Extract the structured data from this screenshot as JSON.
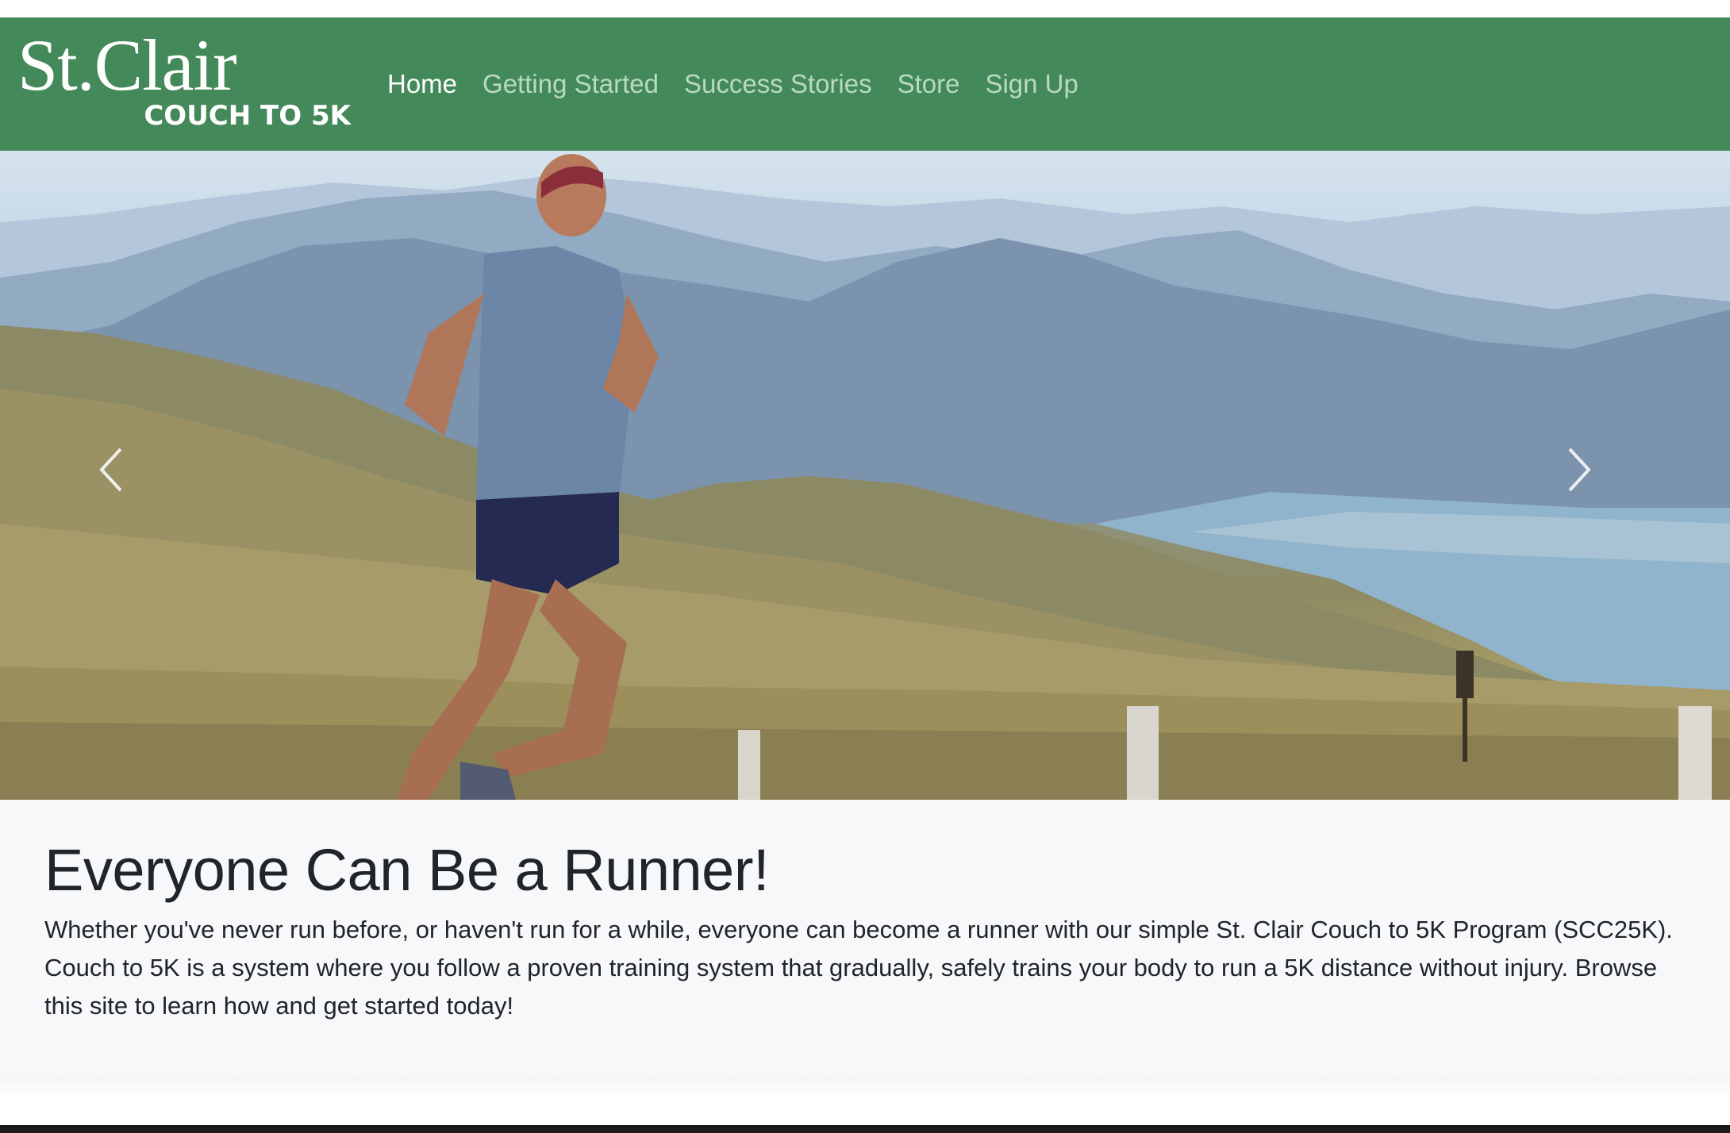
{
  "brand": {
    "main": "St.Clair",
    "sub": "COUCH TO 5K"
  },
  "nav": {
    "items": [
      {
        "label": "Home",
        "active": true
      },
      {
        "label": "Getting Started",
        "active": false
      },
      {
        "label": "Success Stories",
        "active": false
      },
      {
        "label": "Store",
        "active": false
      },
      {
        "label": "Sign Up",
        "active": false
      }
    ]
  },
  "hero": {
    "prev_icon": "chevron-left-icon",
    "next_icon": "chevron-right-icon"
  },
  "content": {
    "heading": "Everyone Can Be a Runner!",
    "body": "Whether you've never run before, or haven't run for a while, everyone can become a runner with our simple St. Clair Couch to 5K Program (SCC25K). Couch to 5K is a system where you follow a proven training system that gradually, safely trains your body to run a 5K distance without injury. Browse this site to learn how and get started today!"
  },
  "colors": {
    "navbar": "#43895a",
    "nav_inactive": "#b9d9c3",
    "nav_active": "#ffffff",
    "content_bg": "#f7f8fa",
    "text": "#212529"
  }
}
